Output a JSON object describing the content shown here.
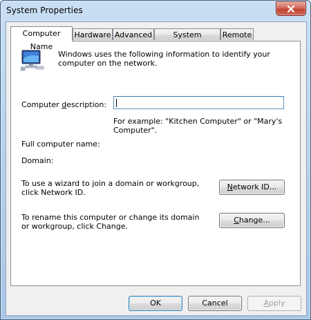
{
  "window": {
    "title": "System Properties"
  },
  "tabs": [
    {
      "label": "Computer Name",
      "active": true
    },
    {
      "label": "Hardware",
      "active": false
    },
    {
      "label": "Advanced",
      "active": false
    },
    {
      "label": "System Protection",
      "active": false
    },
    {
      "label": "Remote",
      "active": false
    }
  ],
  "computer_name": {
    "intro": "Windows uses the following information to identify your computer on the network.",
    "description_label_pre": "Computer ",
    "description_label_key": "d",
    "description_label_post": "escription:",
    "description_value": "",
    "example": "For example: \"Kitchen Computer\" or \"Mary's Computer\".",
    "full_name_label": "Full computer name:",
    "domain_label": "Domain:",
    "network_id_text": "To use a wizard to join a domain or workgroup, click Network ID.",
    "network_id_button_key": "N",
    "network_id_button_rest": "etwork ID...",
    "rename_text": "To rename this computer or change its domain or workgroup, click Change.",
    "change_button_key": "C",
    "change_button_rest": "hange..."
  },
  "buttons": {
    "ok": "OK",
    "cancel": "Cancel",
    "apply_key": "A",
    "apply_rest": "pply"
  },
  "icons": {
    "computer": "computer-icon",
    "close": "close-icon"
  }
}
